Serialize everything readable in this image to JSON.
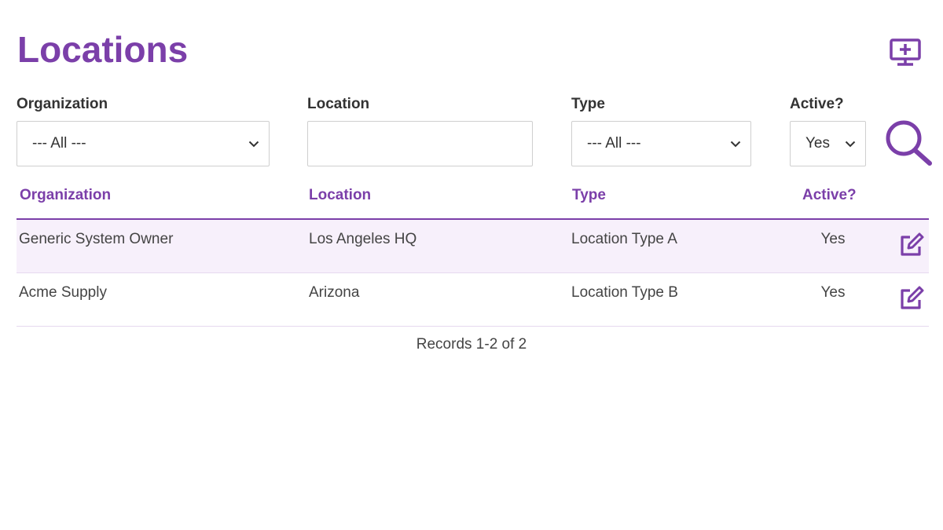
{
  "page": {
    "title": "Locations"
  },
  "icons": {
    "add": "add-screen-icon",
    "search": "search-icon",
    "edit": "edit-icon",
    "chevron": "chevron-down-icon"
  },
  "colors": {
    "accent": "#7b3fa9",
    "row_highlight": "#f7f0fb",
    "row_border": "#e6d9ef"
  },
  "filters": {
    "organization": {
      "label": "Organization",
      "value": "--- All ---"
    },
    "location": {
      "label": "Location",
      "value": ""
    },
    "type": {
      "label": "Type",
      "value": "--- All ---"
    },
    "active": {
      "label": "Active?",
      "value": "Yes"
    }
  },
  "table": {
    "columns": [
      "Organization",
      "Location",
      "Type",
      "Active?"
    ],
    "rows": [
      [
        "Generic System Owner",
        "Los Angeles HQ",
        "Location Type A",
        "Yes"
      ],
      [
        "Acme Supply",
        "Arizona",
        "Location Type B",
        "Yes"
      ]
    ]
  },
  "footer": {
    "records": "Records 1-2 of 2"
  }
}
